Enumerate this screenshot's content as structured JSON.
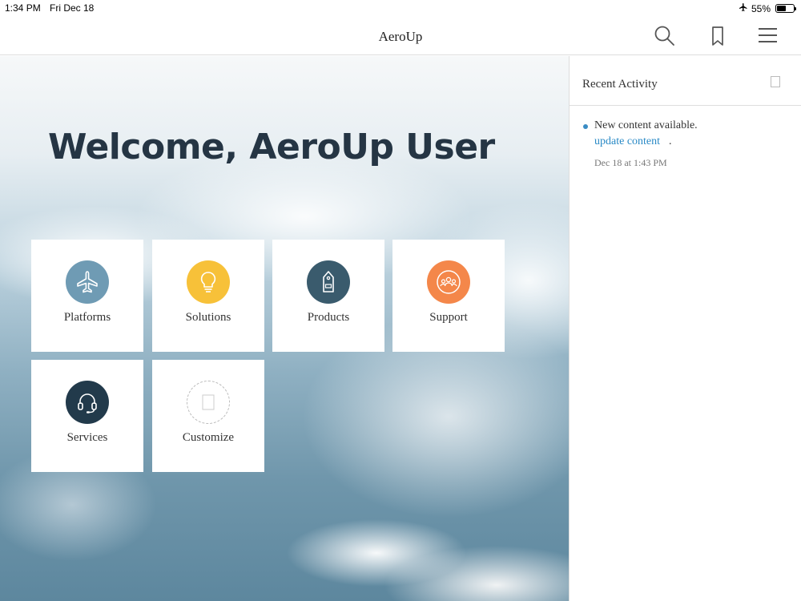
{
  "status_bar": {
    "time": "1:34 PM",
    "date": "Fri Dec 18",
    "battery": "55%",
    "battery_level": 0.55,
    "icons": [
      "airplane-mode-icon",
      "battery-icon"
    ]
  },
  "nav": {
    "title": "AeroUp",
    "icons": [
      "search-icon",
      "bookmark-icon",
      "hamburger-menu-icon"
    ]
  },
  "welcome": "Welcome, AeroUp User",
  "tiles": [
    {
      "label": "Platforms",
      "icon": "airplane-icon",
      "color": "#6f9bb4"
    },
    {
      "label": "Solutions",
      "icon": "lightbulb-icon",
      "color": "#f7c139"
    },
    {
      "label": "Products",
      "icon": "price-tag-icon",
      "color": "#3a5b6d"
    },
    {
      "label": "Support",
      "icon": "people-group-icon",
      "color": "#f4874a"
    },
    {
      "label": "Services",
      "icon": "headset-icon",
      "color": "#223a4b"
    },
    {
      "label": "Customize",
      "icon": "blank-page-icon",
      "color": "#cccccc"
    }
  ],
  "panel": {
    "title": "Recent Activity",
    "activity": {
      "message": "New content available.",
      "link": "update content",
      "suffix": ".",
      "timestamp": "Dec 18 at 1:43 PM"
    },
    "colors": {
      "link": "#2a8ac6",
      "bullet": "#3a8cc4"
    }
  }
}
